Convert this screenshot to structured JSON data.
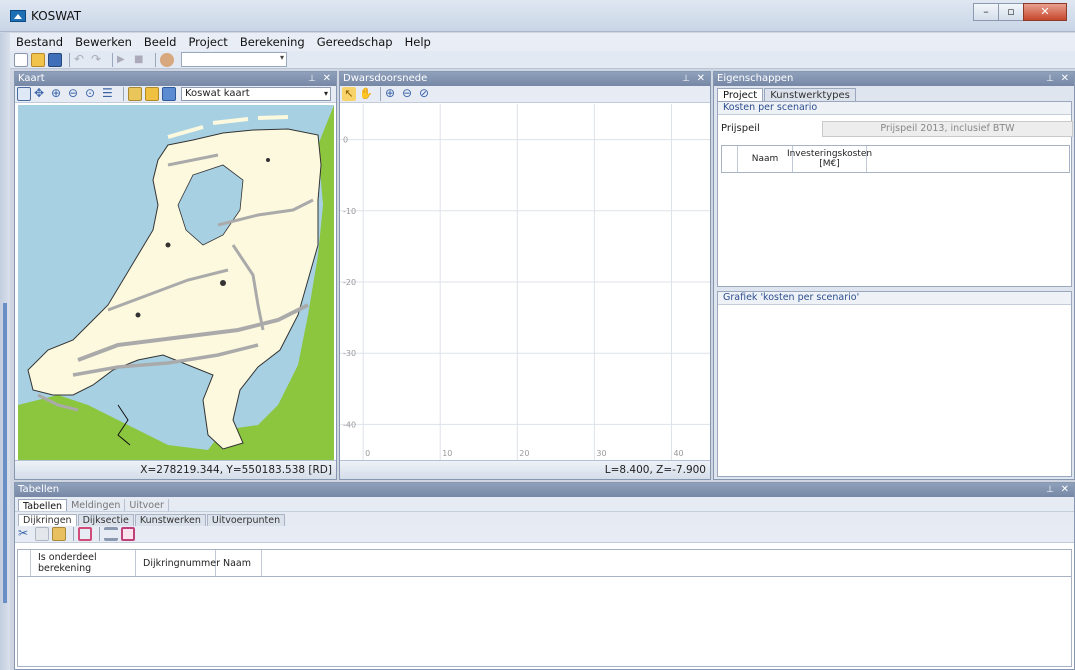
{
  "window": {
    "title": "KOSWAT"
  },
  "menu": [
    "Bestand",
    "Bewerken",
    "Beeld",
    "Project",
    "Berekening",
    "Gereedschap",
    "Help"
  ],
  "kaart": {
    "title": "Kaart",
    "map_layer": "Koswat kaart",
    "status": "X=278219.344, Y=550183.538 [RD]"
  },
  "dwars": {
    "title": "Dwarsdoorsnede",
    "status": "L=8.400, Z=-7.900"
  },
  "chart_data": {
    "type": "line",
    "title": "",
    "xlabel": "",
    "ylabel": "",
    "xlim": [
      -3,
      45
    ],
    "ylim": [
      -45,
      5
    ],
    "x_ticks": [
      "0",
      "10",
      "20",
      "30",
      "40"
    ],
    "y_ticks": [
      "0",
      "-10",
      "-20",
      "-30",
      "-40"
    ],
    "series": [],
    "grid": true
  },
  "eigen": {
    "title": "Eigenschappen",
    "tabs": [
      "Project",
      "Kunstwerktypes"
    ],
    "group1": "Kosten per scenario",
    "prijs_label": "Prijspeil",
    "prijs_value": "Prijspeil 2013, inclusief BTW",
    "col_naam": "Naam",
    "col_kosten_1": "Investeringskosten",
    "col_kosten_2": "[M€]",
    "group2": "Grafiek 'kosten per scenario'"
  },
  "tabellen": {
    "title": "Tabellen",
    "tabs": [
      "Tabellen",
      "Meldingen",
      "Uitvoer"
    ],
    "subtabs": [
      "Dijkringen",
      "Dijksectie",
      "Kunstwerken",
      "Uitvoerpunten"
    ],
    "columns": [
      "Is onderdeel berekening",
      "Dijkringnummer",
      "Naam"
    ]
  },
  "colors": {
    "sea": "#a7d1e3",
    "land": "#fdf9de",
    "neighbour_land": "#8cc63f",
    "panel_header": "#8095b2"
  }
}
